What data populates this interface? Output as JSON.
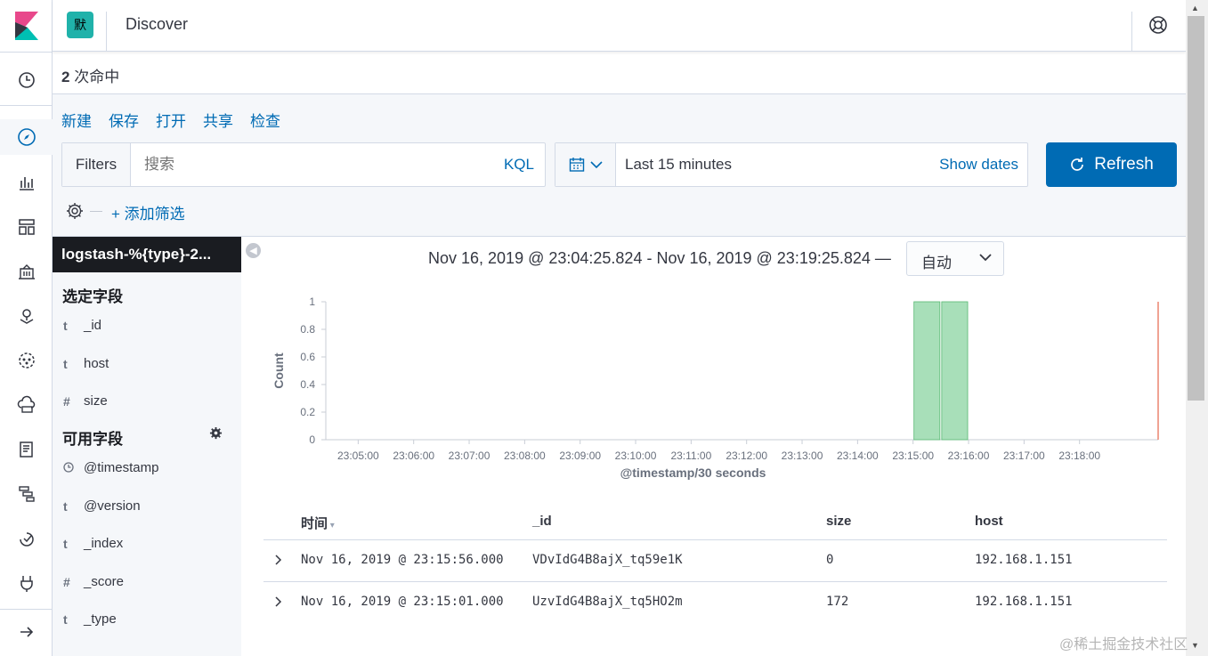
{
  "app": {
    "title": "Discover",
    "space_avatar": "默"
  },
  "hits": {
    "count": "2",
    "label": "次命中"
  },
  "top_nav": [
    "新建",
    "保存",
    "打开",
    "共享",
    "检查"
  ],
  "query": {
    "filters_label": "Filters",
    "search_placeholder": "搜索",
    "language": "KQL",
    "date_range": "Last 15 minutes",
    "show_dates": "Show dates",
    "refresh_label": "Refresh",
    "add_filter": "+ 添加筛选"
  },
  "sidebar": {
    "index_pattern": "logstash-%{type}-2...",
    "selected_title": "选定字段",
    "selected_fields": [
      {
        "type": "t",
        "name": "_id"
      },
      {
        "type": "t",
        "name": "host"
      },
      {
        "type": "#",
        "name": "size"
      }
    ],
    "available_title": "可用字段",
    "available_fields": [
      {
        "type": "clock",
        "name": "@timestamp"
      },
      {
        "type": "t",
        "name": "@version"
      },
      {
        "type": "t",
        "name": "_index"
      },
      {
        "type": "#",
        "name": "_score"
      },
      {
        "type": "t",
        "name": "_type"
      }
    ]
  },
  "chart_header": {
    "range": "Nov 16, 2019 @ 23:04:25.824 - Nov 16, 2019 @ 23:19:25.824 —",
    "interval": "自动"
  },
  "chart_data": {
    "type": "bar",
    "xlabel": "@timestamp/30 seconds",
    "ylabel": "Count",
    "ylim": [
      0,
      1
    ],
    "yticks": [
      "0",
      "0.2",
      "0.4",
      "0.6",
      "0.8",
      "1"
    ],
    "xticks": [
      "23:05:00",
      "23:06:00",
      "23:07:00",
      "23:08:00",
      "23:09:00",
      "23:10:00",
      "23:11:00",
      "23:12:00",
      "23:13:00",
      "23:14:00",
      "23:15:00",
      "23:16:00",
      "23:17:00",
      "23:18:00"
    ],
    "bars": [
      {
        "x": "23:15:00",
        "value": 1
      },
      {
        "x": "23:15:30",
        "value": 1
      }
    ],
    "bar_color": "#a8dfb9",
    "now_marker_color": "#e7664c"
  },
  "table": {
    "headers": [
      "时间",
      "_id",
      "size",
      "host"
    ],
    "rows": [
      [
        "Nov 16, 2019 @ 23:15:56.000",
        "VDvIdG4B8ajX_tq59e1K",
        "0",
        "192.168.1.151"
      ],
      [
        "Nov 16, 2019 @ 23:15:01.000",
        "UzvIdG4B8ajX_tq5HO2m",
        "172",
        "192.168.1.151"
      ]
    ]
  },
  "watermark": "@稀土掘金技术社区",
  "colors": {
    "link": "#006bb4",
    "primary": "#006bb4",
    "dark": "#1a1c21"
  }
}
